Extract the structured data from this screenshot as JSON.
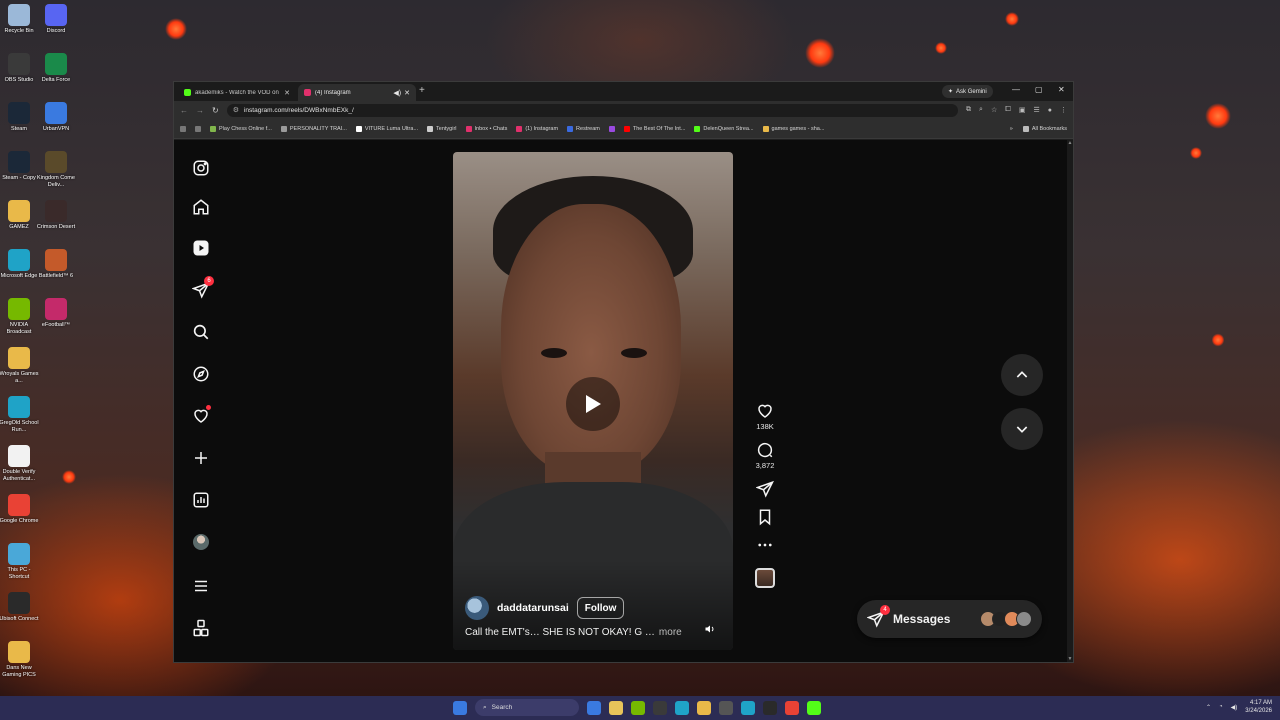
{
  "desktop": {
    "icons_left": [
      {
        "label": "Recycle Bin",
        "color": "#9bb8d8"
      },
      {
        "label": "OBS Studio",
        "color": "#3a3a3a"
      },
      {
        "label": "Steam",
        "color": "#1b2838"
      },
      {
        "label": "Steam - Copy",
        "color": "#1b2838"
      },
      {
        "label": "GAMEZ",
        "color": "#e9b949"
      },
      {
        "label": "Microsoft Edge",
        "color": "#1fa3c7"
      },
      {
        "label": "NVIDIA Broadcast",
        "color": "#76b900"
      },
      {
        "label": "Wroyals Games a...",
        "color": "#e9b949"
      },
      {
        "label": "GregOld School Run...",
        "color": "#1fa3c7"
      },
      {
        "label": "Double Verify Authenticat...",
        "color": "#f2f2f2"
      },
      {
        "label": "Google Chrome",
        "color": "#e94235"
      },
      {
        "label": "This PC - Shortcut",
        "color": "#4aa8d8"
      },
      {
        "label": "Ubisoft Connect",
        "color": "#2a2a2a"
      },
      {
        "label": "Dans New Gaming PICS",
        "color": "#e9b949"
      }
    ],
    "icons_right": [
      {
        "label": "Discord",
        "color": "#5865f2"
      },
      {
        "label": "Delta Force",
        "color": "#1a8a4a"
      },
      {
        "label": "UrbanVPN",
        "color": "#3a7ae0"
      },
      {
        "label": "Kingdom Come Deliv...",
        "color": "#5a4a2a"
      },
      {
        "label": "Crimson Desert",
        "color": "#3a2a2a"
      },
      {
        "label": "Battlefield™ 6",
        "color": "#c45a2a"
      },
      {
        "label": "eFootball™",
        "color": "#c42a6a"
      }
    ]
  },
  "browser": {
    "tabs": [
      {
        "title": "akademiks - Watch the VOD on",
        "active": false,
        "fav_color": "#53fc18"
      },
      {
        "title": "(4) Instagram",
        "active": true,
        "fav_color": "#e1306c"
      }
    ],
    "gemini_label": "Ask Gemini",
    "url": "instagram.com/reels/DWBxNmbEXk_/",
    "bookmarks": [
      {
        "label": "",
        "color": "#777"
      },
      {
        "label": "",
        "color": "#777"
      },
      {
        "label": "Play Chess Online f...",
        "color": "#81b64c"
      },
      {
        "label": "PERSONALITY TRAI...",
        "color": "#9a9a9a"
      },
      {
        "label": "VITURE Luma Ultra...",
        "color": "#ffffff"
      },
      {
        "label": "Tentygirl",
        "color": "#cccccc"
      },
      {
        "label": "Inbox • Chats",
        "color": "#e1306c"
      },
      {
        "label": "(1) Instagram",
        "color": "#e1306c"
      },
      {
        "label": "Restream",
        "color": "#3a6ae0"
      },
      {
        "label": "",
        "color": "#9a4ae0"
      },
      {
        "label": "The Best Of The Int...",
        "color": "#ff0000"
      },
      {
        "label": "DelenQueen Strea...",
        "color": "#53fc18"
      },
      {
        "label": "games games - sha...",
        "color": "#e9b949"
      }
    ],
    "all_bookmarks": "All Bookmarks"
  },
  "instagram": {
    "nav": [
      {
        "name": "instagram-logo-icon"
      },
      {
        "name": "home-icon"
      },
      {
        "name": "reels-icon"
      },
      {
        "name": "messages-icon",
        "badge": "6"
      },
      {
        "name": "search-icon"
      },
      {
        "name": "explore-icon"
      },
      {
        "name": "notifications-icon",
        "dot": true
      },
      {
        "name": "create-icon"
      },
      {
        "name": "dashboard-icon"
      },
      {
        "name": "profile-avatar"
      },
      {
        "name": "menu-icon"
      },
      {
        "name": "also-from-meta-icon"
      }
    ],
    "reel": {
      "username": "daddatarunsai",
      "follow_label": "Follow",
      "caption": "Call the EMT's… SHE IS NOT OKAY! G …",
      "more_label": "more"
    },
    "actions": {
      "likes": "138K",
      "comments": "3,872"
    },
    "messages": {
      "label": "Messages",
      "badge": "4",
      "avatar_colors": [
        "#b58a6a",
        "#222222",
        "#e08a5a",
        "#8a8a8a"
      ]
    }
  },
  "taskbar": {
    "search_label": "Search",
    "time": "4:17 AM",
    "date": "3/24/2026",
    "apps": [
      "#3a7ae0",
      "#e8c45a",
      "#76b900",
      "#3a3a3a",
      "#1fa3c7",
      "#e9b949",
      "#555555",
      "#1fa3c7",
      "#2a2a2a",
      "#e94235",
      "#53fc18"
    ]
  }
}
